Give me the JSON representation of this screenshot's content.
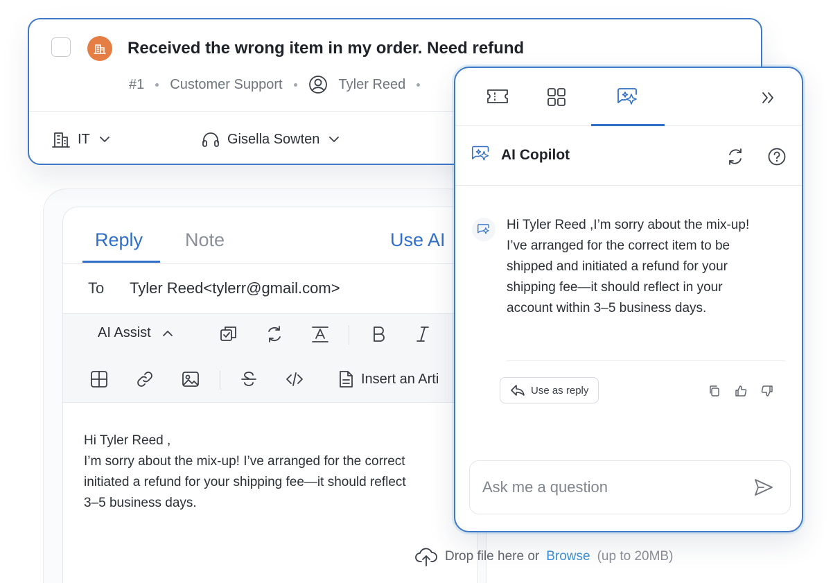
{
  "ticket": {
    "title": "Received the wrong item in my order. Need refund",
    "number": "#1",
    "department": "Customer Support",
    "requester": "Tyler Reed",
    "team": "IT",
    "agent": "Gisella Sowten"
  },
  "editor": {
    "tabs": [
      "Reply",
      "Note"
    ],
    "active_tab": "Reply",
    "use_ai_label": "Use AI",
    "to_label": "To",
    "to_value": "Tyler Reed<tylerr@gmail.com>",
    "ai_assist_label": "AI Assist",
    "insert_article_label": "Insert an Arti",
    "body": "Hi Tyler Reed ,\nI’m sorry about the mix-up! I’ve arranged for the correct\ninitiated a refund for your shipping fee—it should reflect\n3–5 business days.",
    "drop_text": "Drop file here or",
    "browse_label": "Browse",
    "size_limit": "(up to 20MB)"
  },
  "copilot": {
    "title": "AI Copilot",
    "message": "Hi Tyler Reed ,I’m sorry about the mix-up! I’ve arranged for the correct item to be shipped and initiated a refund for your shipping fee—it should reflect in your account within 3–5 business days.",
    "use_as_reply_label": "Use as reply",
    "ask_placeholder": "Ask me a question"
  },
  "colors": {
    "accent": "#2f6fc8",
    "avatar_orange": "#e47e45",
    "link": "#3d8fd6"
  },
  "icons": {
    "ticket_tab": "ticket-icon",
    "apps_tab": "grid-icon",
    "copilot_tab": "sparkle-chat-icon",
    "collapse": "double-chevron-right-icon",
    "refresh": "refresh-icon",
    "help": "help-icon"
  }
}
